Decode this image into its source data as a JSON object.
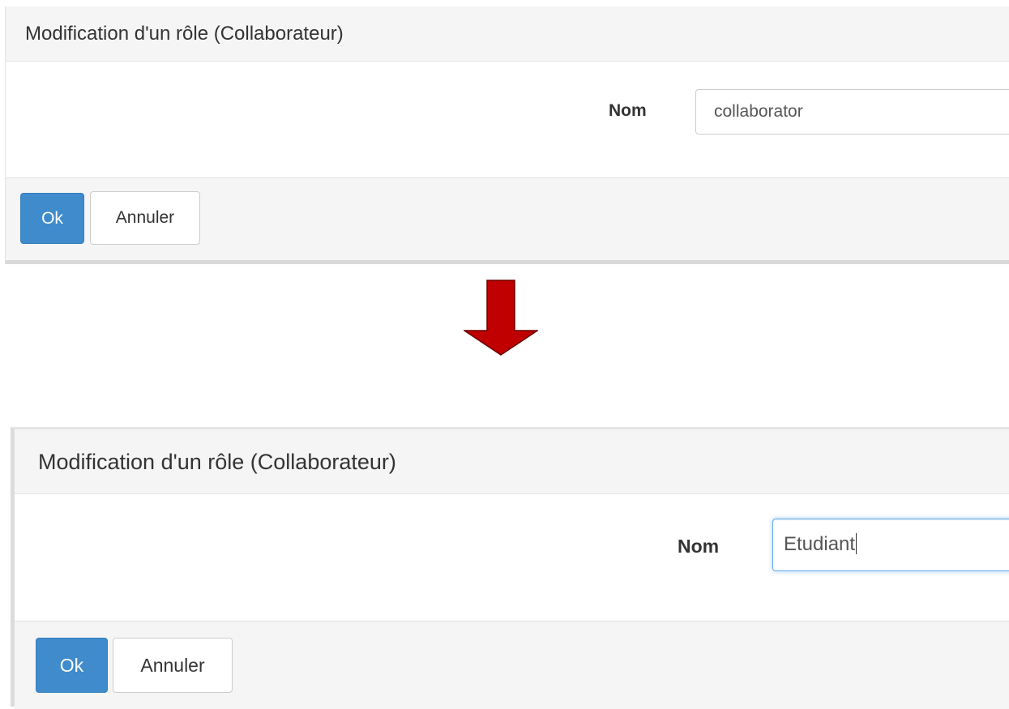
{
  "before": {
    "title": "Modification d'un rôle (Collaborateur)",
    "field_label": "Nom",
    "field_value": "collaborator",
    "ok_label": "Ok",
    "cancel_label": "Annuler"
  },
  "after": {
    "title": "Modification d'un rôle (Collaborateur)",
    "field_label": "Nom",
    "field_value": "Etudiant",
    "ok_label": "Ok",
    "cancel_label": "Annuler"
  },
  "arrow": {
    "icon": "down-arrow-icon",
    "color": "#c00000"
  },
  "colors": {
    "primary_button": "#3f8bcc",
    "panel_bg": "#f5f5f5",
    "focus_border": "#66afe9"
  }
}
